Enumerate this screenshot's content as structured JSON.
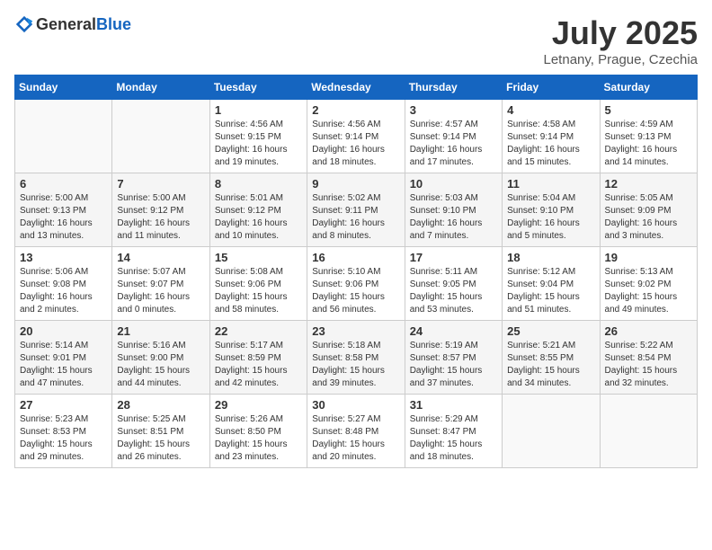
{
  "logo": {
    "general": "General",
    "blue": "Blue"
  },
  "title": {
    "month": "July 2025",
    "location": "Letnany, Prague, Czechia"
  },
  "weekdays": [
    "Sunday",
    "Monday",
    "Tuesday",
    "Wednesday",
    "Thursday",
    "Friday",
    "Saturday"
  ],
  "weeks": [
    [
      {
        "day": "",
        "info": ""
      },
      {
        "day": "",
        "info": ""
      },
      {
        "day": "1",
        "info": "Sunrise: 4:56 AM\nSunset: 9:15 PM\nDaylight: 16 hours and 19 minutes."
      },
      {
        "day": "2",
        "info": "Sunrise: 4:56 AM\nSunset: 9:14 PM\nDaylight: 16 hours and 18 minutes."
      },
      {
        "day": "3",
        "info": "Sunrise: 4:57 AM\nSunset: 9:14 PM\nDaylight: 16 hours and 17 minutes."
      },
      {
        "day": "4",
        "info": "Sunrise: 4:58 AM\nSunset: 9:14 PM\nDaylight: 16 hours and 15 minutes."
      },
      {
        "day": "5",
        "info": "Sunrise: 4:59 AM\nSunset: 9:13 PM\nDaylight: 16 hours and 14 minutes."
      }
    ],
    [
      {
        "day": "6",
        "info": "Sunrise: 5:00 AM\nSunset: 9:13 PM\nDaylight: 16 hours and 13 minutes."
      },
      {
        "day": "7",
        "info": "Sunrise: 5:00 AM\nSunset: 9:12 PM\nDaylight: 16 hours and 11 minutes."
      },
      {
        "day": "8",
        "info": "Sunrise: 5:01 AM\nSunset: 9:12 PM\nDaylight: 16 hours and 10 minutes."
      },
      {
        "day": "9",
        "info": "Sunrise: 5:02 AM\nSunset: 9:11 PM\nDaylight: 16 hours and 8 minutes."
      },
      {
        "day": "10",
        "info": "Sunrise: 5:03 AM\nSunset: 9:10 PM\nDaylight: 16 hours and 7 minutes."
      },
      {
        "day": "11",
        "info": "Sunrise: 5:04 AM\nSunset: 9:10 PM\nDaylight: 16 hours and 5 minutes."
      },
      {
        "day": "12",
        "info": "Sunrise: 5:05 AM\nSunset: 9:09 PM\nDaylight: 16 hours and 3 minutes."
      }
    ],
    [
      {
        "day": "13",
        "info": "Sunrise: 5:06 AM\nSunset: 9:08 PM\nDaylight: 16 hours and 2 minutes."
      },
      {
        "day": "14",
        "info": "Sunrise: 5:07 AM\nSunset: 9:07 PM\nDaylight: 16 hours and 0 minutes."
      },
      {
        "day": "15",
        "info": "Sunrise: 5:08 AM\nSunset: 9:06 PM\nDaylight: 15 hours and 58 minutes."
      },
      {
        "day": "16",
        "info": "Sunrise: 5:10 AM\nSunset: 9:06 PM\nDaylight: 15 hours and 56 minutes."
      },
      {
        "day": "17",
        "info": "Sunrise: 5:11 AM\nSunset: 9:05 PM\nDaylight: 15 hours and 53 minutes."
      },
      {
        "day": "18",
        "info": "Sunrise: 5:12 AM\nSunset: 9:04 PM\nDaylight: 15 hours and 51 minutes."
      },
      {
        "day": "19",
        "info": "Sunrise: 5:13 AM\nSunset: 9:02 PM\nDaylight: 15 hours and 49 minutes."
      }
    ],
    [
      {
        "day": "20",
        "info": "Sunrise: 5:14 AM\nSunset: 9:01 PM\nDaylight: 15 hours and 47 minutes."
      },
      {
        "day": "21",
        "info": "Sunrise: 5:16 AM\nSunset: 9:00 PM\nDaylight: 15 hours and 44 minutes."
      },
      {
        "day": "22",
        "info": "Sunrise: 5:17 AM\nSunset: 8:59 PM\nDaylight: 15 hours and 42 minutes."
      },
      {
        "day": "23",
        "info": "Sunrise: 5:18 AM\nSunset: 8:58 PM\nDaylight: 15 hours and 39 minutes."
      },
      {
        "day": "24",
        "info": "Sunrise: 5:19 AM\nSunset: 8:57 PM\nDaylight: 15 hours and 37 minutes."
      },
      {
        "day": "25",
        "info": "Sunrise: 5:21 AM\nSunset: 8:55 PM\nDaylight: 15 hours and 34 minutes."
      },
      {
        "day": "26",
        "info": "Sunrise: 5:22 AM\nSunset: 8:54 PM\nDaylight: 15 hours and 32 minutes."
      }
    ],
    [
      {
        "day": "27",
        "info": "Sunrise: 5:23 AM\nSunset: 8:53 PM\nDaylight: 15 hours and 29 minutes."
      },
      {
        "day": "28",
        "info": "Sunrise: 5:25 AM\nSunset: 8:51 PM\nDaylight: 15 hours and 26 minutes."
      },
      {
        "day": "29",
        "info": "Sunrise: 5:26 AM\nSunset: 8:50 PM\nDaylight: 15 hours and 23 minutes."
      },
      {
        "day": "30",
        "info": "Sunrise: 5:27 AM\nSunset: 8:48 PM\nDaylight: 15 hours and 20 minutes."
      },
      {
        "day": "31",
        "info": "Sunrise: 5:29 AM\nSunset: 8:47 PM\nDaylight: 15 hours and 18 minutes."
      },
      {
        "day": "",
        "info": ""
      },
      {
        "day": "",
        "info": ""
      }
    ]
  ]
}
